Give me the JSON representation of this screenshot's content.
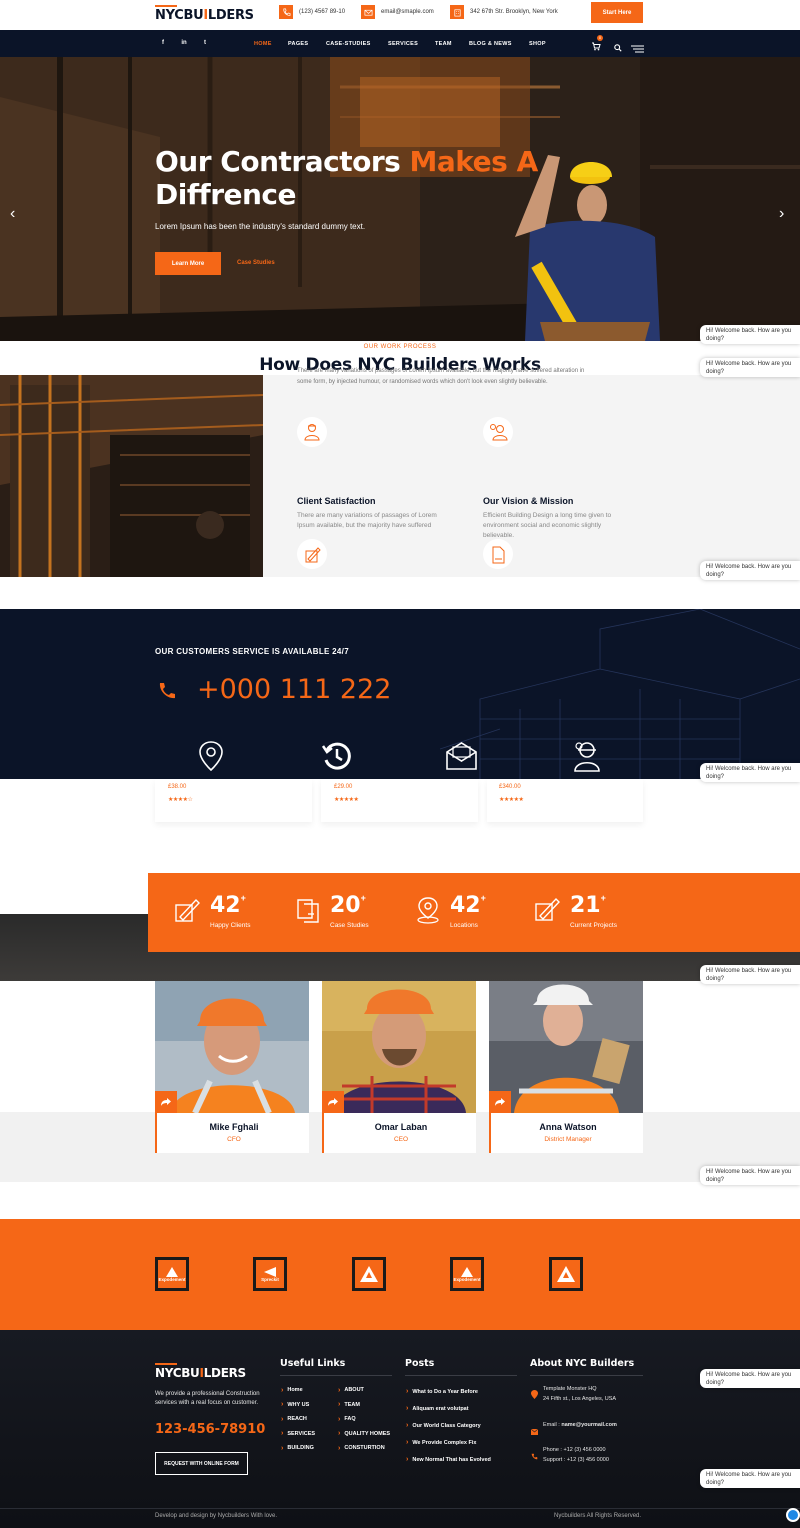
{
  "brand": {
    "logo_main": "NYCBU",
    "logo_accent": "I",
    "logo_tail": "LDERS"
  },
  "topbar": {
    "phone": "(123) 4567 89-10",
    "email": "email@smaple.com",
    "address": "342 67th Str. Brooklyn, New York",
    "start_label": "Start Here"
  },
  "nav": {
    "items": [
      {
        "label": "HOME",
        "active": true
      },
      {
        "label": "PAGES"
      },
      {
        "label": "CASE-STUDIES"
      },
      {
        "label": "SERVICES"
      },
      {
        "label": "TEAM"
      },
      {
        "label": "BLOG & NEWS"
      },
      {
        "label": "SHOP"
      }
    ],
    "social": [
      "facebook-icon",
      "linkedin-icon",
      "twitter-icon"
    ],
    "cart_count": "0"
  },
  "hero": {
    "title_white": "Our Contractors ",
    "title_orange": "Makes A",
    "title_line2": "Diffrence",
    "subtitle": "Lorem Ipsum has been the industry's standard dummy text.",
    "learn_more": "Learn More",
    "case_studies": "Case Studies"
  },
  "process": {
    "eyebrow": "OUR WORK PROCESS",
    "title": "How Does NYC Builders Works",
    "desc_line1": "There are many variations of passages of Lorem Ipsum available, but the majority have suffered alteration in",
    "desc_line2": "some form, by injected humour, or randomised words which don't look even slightly believable.",
    "features": [
      {
        "title": "Client Satisfaction",
        "text": "There are many variations of passages of Lorem Ipsum available, but the majority have suffered"
      },
      {
        "title": "Our Vision & Mission",
        "text": "Efficient Building Design a long time given to environment social and economic slightly believable."
      }
    ]
  },
  "chat": {
    "message": "Hi! Welcome back. How are you doing?"
  },
  "service": {
    "heading": "OUR CUSTOMERS SERVICE IS AVAILABLE 24/7",
    "phone": "+000 111 222"
  },
  "products": [
    {
      "price": "£38.00",
      "stars": "★★★★☆"
    },
    {
      "price": "£29.00",
      "stars": "★★★★★"
    },
    {
      "price": "£340.00",
      "stars": "★★★★★"
    }
  ],
  "stats": [
    {
      "value": "42",
      "label": "Happy Clients"
    },
    {
      "value": "20",
      "label": "Case Studies"
    },
    {
      "value": "42",
      "label": "Locations"
    },
    {
      "value": "21",
      "label": "Current Projects"
    }
  ],
  "team": [
    {
      "name": "Mike Fghali",
      "role": "CFO"
    },
    {
      "name": "Omar Laban",
      "role": "CEO"
    },
    {
      "name": "Anna Watson",
      "role": "District Manager"
    }
  ],
  "brands": [
    "Expodement",
    "Spreckit",
    "Ascend",
    "Expodement",
    "Ascend"
  ],
  "footer": {
    "about_text": "We provide a professional Construction services with a real focus on customer.",
    "phone": "123-456-78910",
    "form_button": "REQUEST WITH ONLINE FORM",
    "useful_links_title": "Useful Links",
    "links_col1": [
      "Home",
      "WHY US",
      "REACH",
      "SERVICES",
      "BUILDING"
    ],
    "links_col2": [
      "ABOUT",
      "TEAM",
      "FAQ",
      "QUALITY HOMES",
      "CONSTURTION"
    ],
    "posts_title": "Posts",
    "posts": [
      "What to Do a Year Before",
      "Aliquam erat volutpat",
      "Our World Class Category",
      "We Provide Complex Fix",
      "New Normal That has Evolved"
    ],
    "about_title": "About NYC Builders",
    "address_line1": "Template Monster HQ",
    "address_line2": "24 Fifth st., Los Angeles, USA",
    "email_label": "Email : ",
    "email_value": "name@yourmail.com",
    "phone_line": "Phone : +12 (3) 456 0000",
    "support_line": "Support : +12 (3) 456 0000",
    "credit": "Develop and design by Nycbuilders With love.",
    "rights": "Nycbuilders All Rights Reserved."
  },
  "colors": {
    "accent": "#f56717",
    "navy": "#0b1428"
  }
}
